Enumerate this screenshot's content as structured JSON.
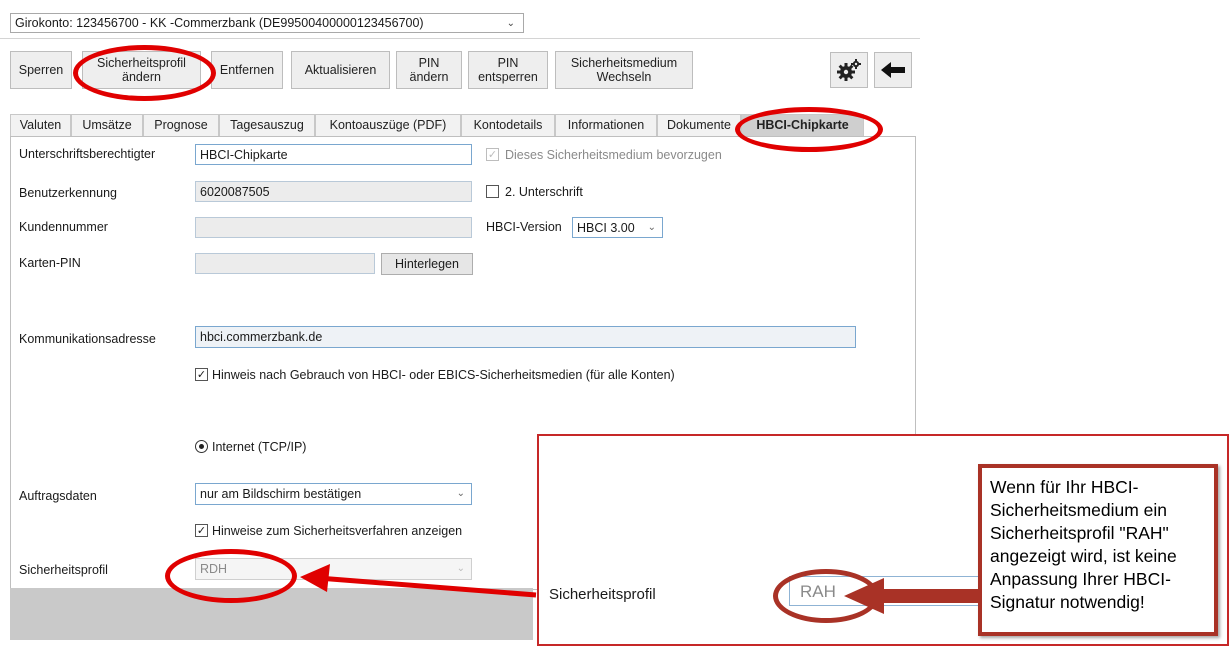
{
  "account": {
    "selected": "Girokonto: 123456700 - KK -Commerzbank (DE99500400000123456700)"
  },
  "toolbar": {
    "buttons": [
      {
        "label": "Sperren"
      },
      {
        "label": "Sicherheitsprofil\nändern"
      },
      {
        "label": "Entfernen"
      },
      {
        "label": "Aktualisieren"
      },
      {
        "label": "PIN\nändern"
      },
      {
        "label": "PIN\nentsperren"
      },
      {
        "label": "Sicherheitsmedium\nWechseln"
      }
    ],
    "icons": [
      "gears-icon",
      "arrow-left-icon"
    ]
  },
  "tabs": [
    {
      "label": "Valuten"
    },
    {
      "label": "Umsätze"
    },
    {
      "label": "Prognose"
    },
    {
      "label": "Tagesauszug"
    },
    {
      "label": "Kontoauszüge (PDF)"
    },
    {
      "label": "Kontodetails"
    },
    {
      "label": "Informationen"
    },
    {
      "label": "Dokumente"
    },
    {
      "label": "HBCI-Chipkarte",
      "active": true
    }
  ],
  "form": {
    "unterschrift_label": "Unterschriftsberechtigter",
    "unterschrift_value": "HBCI-Chipkarte",
    "bevorzugen_label": "Dieses Sicherheitsmedium bevorzugen",
    "benutzer_label": "Benutzerkennung",
    "benutzer_value": "6020087505",
    "zweite_label": "2. Unterschrift",
    "kunden_label": "Kundennummer",
    "kunden_value": "",
    "hbci_version_label": "HBCI-Version",
    "hbci_version_value": "HBCI 3.00",
    "pin_label": "Karten-PIN",
    "pin_value": "",
    "hinterlegen_label": "Hinterlegen",
    "komm_label": "Kommunikationsadresse",
    "komm_value": "hbci.commerzbank.de",
    "hinweis_label": "Hinweis nach Gebrauch von HBCI- oder EBICS-Sicherheitsmedien (für alle Konten)",
    "internet_label": "Internet (TCP/IP)",
    "auftrag_label": "Auftragsdaten",
    "auftrag_value": "nur am Bildschirm bestätigen",
    "hinweise_label": "Hinweise zum Sicherheitsverfahren anzeigen",
    "profil_label": "Sicherheitsprofil",
    "profil_value": "RDH"
  },
  "zoom": {
    "profil_label": "Sicherheitsprofil",
    "profil_value": "RAH"
  },
  "callout": {
    "text": "Wenn für Ihr HBCI-Sicherheitsmedium ein Sicherheitsprofil \"RAH\" angezeigt wird, ist keine Anpassung Ihrer HBCI-Signatur notwendig!"
  },
  "colors": {
    "highlight": "#e00000",
    "callout_border": "#a93226",
    "field_border": "#7aa7cf"
  }
}
